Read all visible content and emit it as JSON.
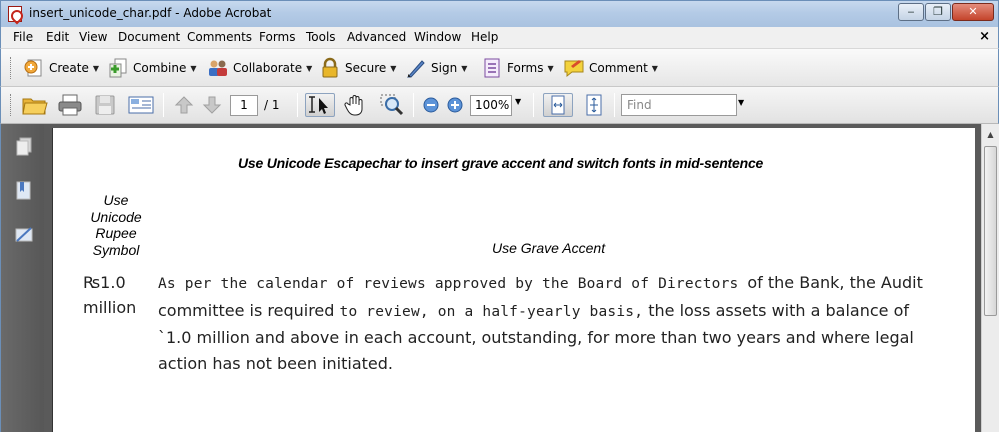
{
  "window": {
    "title": "insert_unicode_char.pdf - Adobe Acrobat",
    "controls": {
      "minimize": "‒",
      "maximize": "❐",
      "close": "✕"
    }
  },
  "menubar": {
    "items": [
      "File",
      "Edit",
      "View",
      "Document",
      "Comments",
      "Forms",
      "Tools",
      "Advanced",
      "Window",
      "Help"
    ],
    "close_glyph": "×"
  },
  "task_toolbar": {
    "buttons": [
      {
        "label": "Create",
        "icon": "create-icon"
      },
      {
        "label": "Combine",
        "icon": "combine-icon"
      },
      {
        "label": "Collaborate",
        "icon": "collaborate-icon"
      },
      {
        "label": "Secure",
        "icon": "lock-icon"
      },
      {
        "label": "Sign",
        "icon": "pen-icon"
      },
      {
        "label": "Forms",
        "icon": "forms-icon"
      },
      {
        "label": "Comment",
        "icon": "comment-icon"
      }
    ]
  },
  "std_toolbar": {
    "page_current": "1",
    "page_total": "/ 1",
    "zoom": "100%",
    "find_placeholder": "Find"
  },
  "document": {
    "heading": "Use Unicode Escapechar to insert grave accent and switch fonts in mid-sentence",
    "col1_header": "Use Unicode Rupee Symbol",
    "col2_header": "Use Grave Accent",
    "rupee_value": "₨1.0 million",
    "text_mono_1": "As per the calendar of reviews approved by the Board of Directors ",
    "text_sans_1": " of the Bank, the Audit committee is required ",
    "text_mono_2": "to review, on a half-yearly basis,",
    "text_sans_2": " the loss assets with a balance of `1.0 million and above in each account, outstanding, for more than two years and where legal action has not been initiated."
  },
  "colors": {
    "titlebar": "#b4cbe6",
    "workspace": "#5a5a5a",
    "navpane": "#575757",
    "acrobat_red": "#c4261c"
  }
}
